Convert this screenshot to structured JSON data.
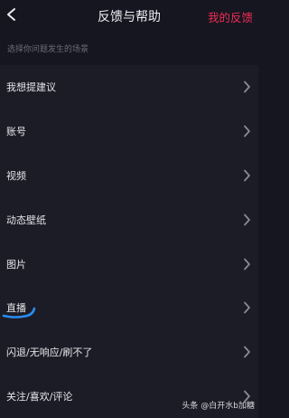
{
  "header": {
    "title": "反馈与帮助",
    "right_link": "我的反馈",
    "back_icon": "chevron-left-icon"
  },
  "subheader": {
    "text": "选择你问题发生的场景"
  },
  "rows": [
    {
      "label": "我想提建议"
    },
    {
      "label": "账号"
    },
    {
      "label": "视频"
    },
    {
      "label": "动态壁纸"
    },
    {
      "label": "图片"
    },
    {
      "label": "直播"
    },
    {
      "label": "闪退/无响应/刷不了"
    },
    {
      "label": "关注/喜欢/评论"
    }
  ],
  "annotation": {
    "color": "#2a8cf0",
    "target": "直播"
  },
  "watermark": "头条 @白开水b加糖",
  "colors": {
    "background": "#15161f",
    "list_background": "#1b1c26",
    "accent": "#ee2b55",
    "chevron": "#8a8a96"
  }
}
